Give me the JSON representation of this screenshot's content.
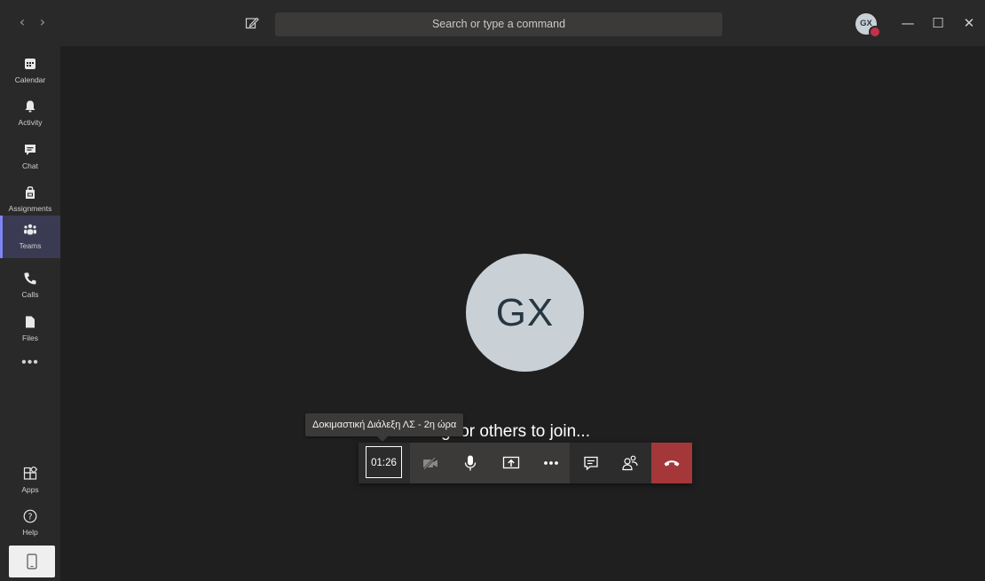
{
  "titlebar": {
    "search_placeholder": "Search or type a command",
    "avatar_initials": "GX"
  },
  "rail": {
    "items": [
      {
        "label": "Calendar",
        "icon": "calendar-icon"
      },
      {
        "label": "Activity",
        "icon": "bell-icon"
      },
      {
        "label": "Chat",
        "icon": "chat-icon"
      },
      {
        "label": "Assignments",
        "icon": "assignments-icon"
      },
      {
        "label": "Teams",
        "icon": "teams-icon",
        "active": true
      },
      {
        "label": "Calls",
        "icon": "phone-icon"
      },
      {
        "label": "Files",
        "icon": "file-icon"
      }
    ],
    "more": "•••",
    "bottom": [
      {
        "label": "Apps",
        "icon": "apps-icon"
      },
      {
        "label": "Help",
        "icon": "help-icon"
      }
    ]
  },
  "stage": {
    "avatar_initials": "GX",
    "status": "Waiting for others to join...",
    "tooltip": "Δοκιμαστική Διάλεξη ΛΣ - 2η ώρα"
  },
  "callbar": {
    "timer": "01:26"
  },
  "colors": {
    "accent": "#7f85f5",
    "hangup": "#a4373a",
    "presence_busy": "#c4314b",
    "avatar_bg": "#c9d1d7"
  }
}
